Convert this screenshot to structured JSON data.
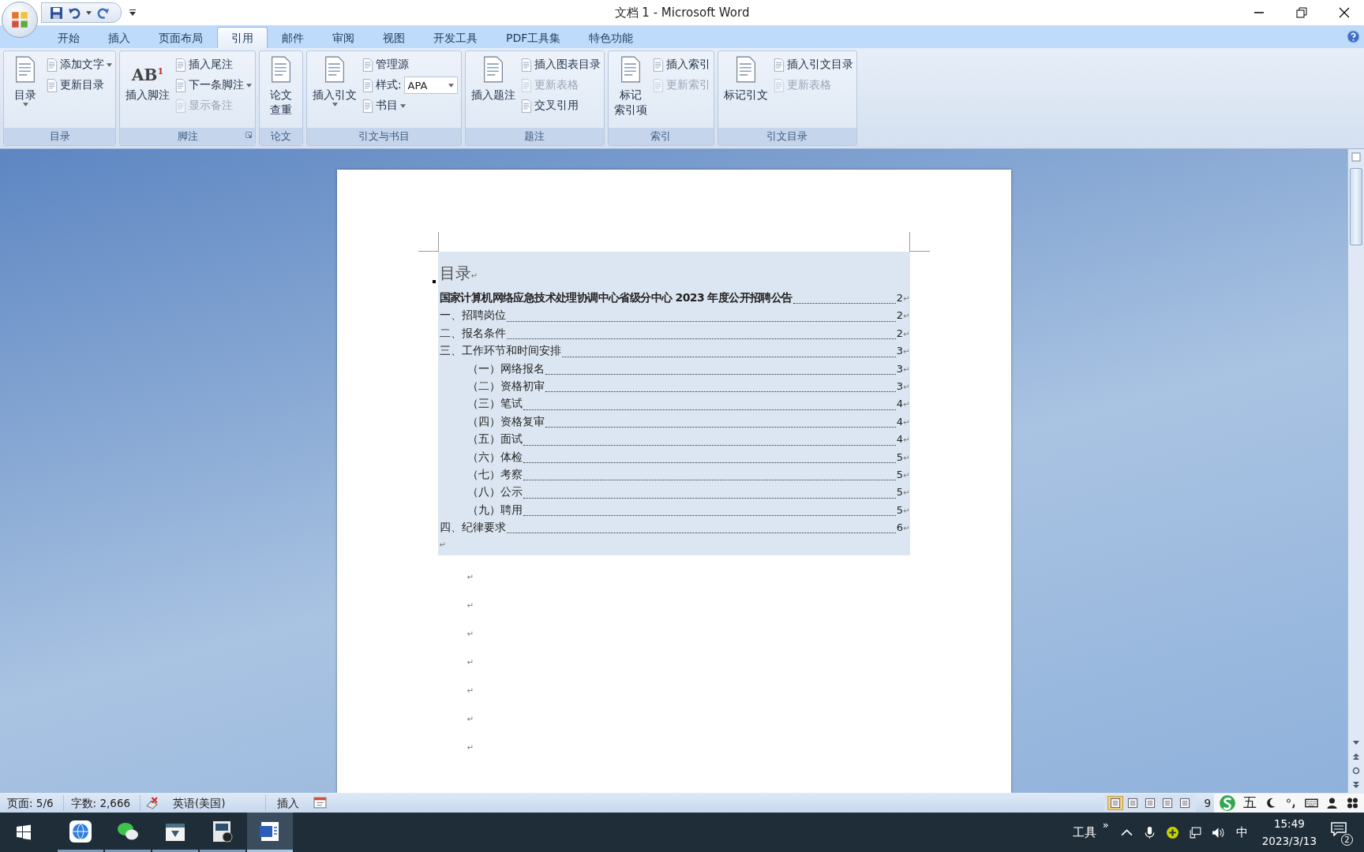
{
  "window": {
    "title": "文档 1 - Microsoft Word"
  },
  "tabs": [
    {
      "label": "开始",
      "selected": false
    },
    {
      "label": "插入",
      "selected": false
    },
    {
      "label": "页面布局",
      "selected": false
    },
    {
      "label": "引用",
      "selected": true
    },
    {
      "label": "邮件",
      "selected": false
    },
    {
      "label": "审阅",
      "selected": false
    },
    {
      "label": "视图",
      "selected": false
    },
    {
      "label": "开发工具",
      "selected": false
    },
    {
      "label": "PDF工具集",
      "selected": false
    },
    {
      "label": "特色功能",
      "selected": false
    }
  ],
  "ribbon": [
    {
      "label": "目录",
      "launcher": false,
      "columns": [
        {
          "kind": "large",
          "lines": [
            "目录"
          ],
          "dropdown": true
        },
        {
          "kind": "stack",
          "items": [
            {
              "kind": "button",
              "label": "添加文字",
              "disabled": false,
              "dropdown": true
            },
            {
              "kind": "button",
              "label": "更新目录",
              "disabled": false,
              "dropdown": false
            }
          ]
        }
      ]
    },
    {
      "label": "脚注",
      "launcher": true,
      "columns": [
        {
          "kind": "large",
          "lines": [
            "插入脚注"
          ],
          "glyph": "AB$^{1}$",
          "dropdown": false
        },
        {
          "kind": "stack",
          "items": [
            {
              "kind": "button",
              "label": "插入尾注",
              "disabled": false,
              "dropdown": false
            },
            {
              "kind": "button",
              "label": "下一条脚注",
              "disabled": false,
              "dropdown": true
            },
            {
              "kind": "button",
              "label": "显示备注",
              "disabled": true,
              "dropdown": false
            }
          ]
        }
      ]
    },
    {
      "label": "论文",
      "launcher": false,
      "columns": [
        {
          "kind": "large",
          "lines": [
            "论文",
            "查重"
          ],
          "dropdown": false
        }
      ]
    },
    {
      "label": "引文与书目",
      "launcher": false,
      "columns": [
        {
          "kind": "large",
          "lines": [
            "插入引文"
          ],
          "dropdown": true
        },
        {
          "kind": "stack",
          "items": [
            {
              "kind": "button",
              "label": "管理源",
              "disabled": false,
              "dropdown": false
            },
            {
              "kind": "combo",
              "label": "样式:",
              "value": "APA",
              "disabled": false,
              "dropdown": true
            },
            {
              "kind": "button",
              "label": "书目",
              "disabled": false,
              "dropdown": true
            }
          ]
        }
      ]
    },
    {
      "label": "题注",
      "launcher": false,
      "columns": [
        {
          "kind": "large",
          "lines": [
            "插入题注"
          ],
          "dropdown": false
        },
        {
          "kind": "stack",
          "items": [
            {
              "kind": "button",
              "label": "插入图表目录",
              "disabled": false,
              "dropdown": false
            },
            {
              "kind": "button",
              "label": "更新表格",
              "disabled": true,
              "dropdown": false
            },
            {
              "kind": "button",
              "label": "交叉引用",
              "disabled": false,
              "dropdown": false
            }
          ]
        }
      ]
    },
    {
      "label": "索引",
      "launcher": false,
      "columns": [
        {
          "kind": "large",
          "lines": [
            "标记",
            "索引项"
          ],
          "dropdown": false
        },
        {
          "kind": "stack",
          "items": [
            {
              "kind": "button",
              "label": "插入索引",
              "disabled": false,
              "dropdown": false
            },
            {
              "kind": "button",
              "label": "更新索引",
              "disabled": true,
              "dropdown": false
            }
          ]
        }
      ]
    },
    {
      "label": "引文目录",
      "launcher": false,
      "columns": [
        {
          "kind": "large",
          "lines": [
            "标记引文"
          ],
          "dropdown": false
        },
        {
          "kind": "stack",
          "items": [
            {
              "kind": "button",
              "label": "插入引文目录",
              "disabled": false,
              "dropdown": false
            },
            {
              "kind": "button",
              "label": "更新表格",
              "disabled": true,
              "dropdown": false
            }
          ]
        }
      ]
    }
  ],
  "document": {
    "toc": {
      "heading": "目录",
      "heading_mark": "↵",
      "end_mark": "↵",
      "entries": [
        {
          "kind": "heading",
          "text": "国家计算机网络应急技术处理协调中心省级分中心 2023 年度公开招聘公告",
          "page": "2",
          "mark": "↵"
        },
        {
          "kind": "section",
          "text": "一、招聘岗位",
          "page": "2",
          "mark": "↵"
        },
        {
          "kind": "section",
          "text": "二、报名条件",
          "page": "2",
          "mark": "↵"
        },
        {
          "kind": "section",
          "text": "三、工作环节和时间安排",
          "page": "3",
          "mark": "↵",
          "children": [
            {
              "kind": "section",
              "text": "（一）网络报名",
              "page": "3",
              "mark": "↵"
            },
            {
              "kind": "section",
              "text": "（二）资格初审",
              "page": "3",
              "mark": "↵"
            },
            {
              "kind": "section",
              "text": "（三）笔试",
              "page": "4",
              "mark": "↵"
            },
            {
              "kind": "section",
              "text": "（四）资格复审",
              "page": "4",
              "mark": "↵"
            },
            {
              "kind": "section",
              "text": "（五）面试",
              "page": "4",
              "mark": "↵"
            },
            {
              "kind": "section",
              "text": "（六）体检",
              "page": "5",
              "mark": "↵"
            },
            {
              "kind": "section",
              "text": "（七）考察",
              "page": "5",
              "mark": "↵"
            },
            {
              "kind": "section",
              "text": "（八）公示",
              "page": "5",
              "mark": "↵"
            },
            {
              "kind": "section",
              "text": "（九）聘用",
              "page": "5",
              "mark": "↵"
            }
          ]
        },
        {
          "kind": "section",
          "text": "四、纪律要求",
          "page": "6",
          "mark": "↵"
        }
      ]
    },
    "paragraph_marks": [
      "↵",
      "↵",
      "↵",
      "↵",
      "↵",
      "↵",
      "↵"
    ]
  },
  "status_bar": {
    "page": "页面: 5/6",
    "words": "字数: 2,666",
    "language": "英语(美国)",
    "mode": "插入",
    "views": [
      {
        "selected": true
      },
      {
        "selected": false
      },
      {
        "selected": false
      },
      {
        "selected": false
      },
      {
        "selected": false
      }
    ],
    "zoom": "9"
  },
  "ime_bar": {
    "mode": "五"
  },
  "taskbar": {
    "apps": [
      {
        "kind": "browser",
        "selected": false
      },
      {
        "kind": "chat",
        "selected": false
      },
      {
        "kind": "viewer",
        "selected": false
      },
      {
        "kind": "video",
        "selected": false
      },
      {
        "kind": "word",
        "selected": true
      }
    ],
    "tray": {
      "label": "工具",
      "overflow": "»",
      "input": "中",
      "time": "15:49",
      "date": "2023/3/13",
      "notifications": "2"
    }
  }
}
